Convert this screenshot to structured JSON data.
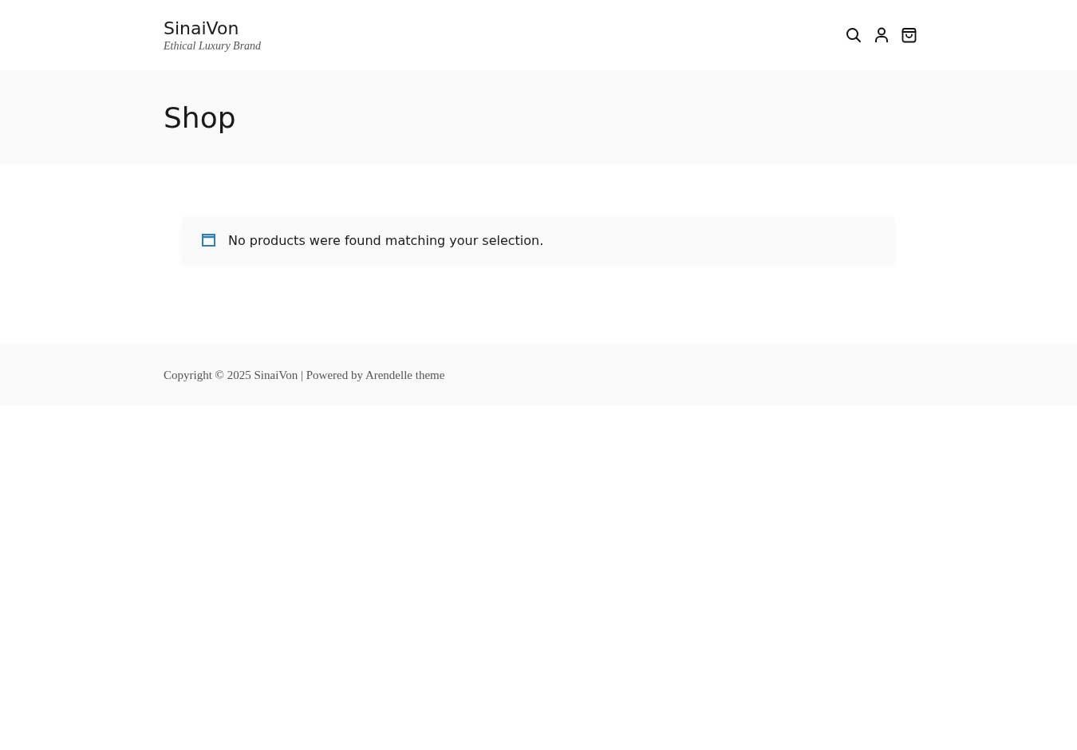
{
  "site": {
    "title": "SinaiVon",
    "tagline": "Ethical Luxury Brand"
  },
  "page_title": "Shop",
  "notice": {
    "text": "No products were found matching your selection."
  },
  "footer": {
    "text": "Copyright © 2025 SinaiVon | Powered by Arendelle theme"
  }
}
